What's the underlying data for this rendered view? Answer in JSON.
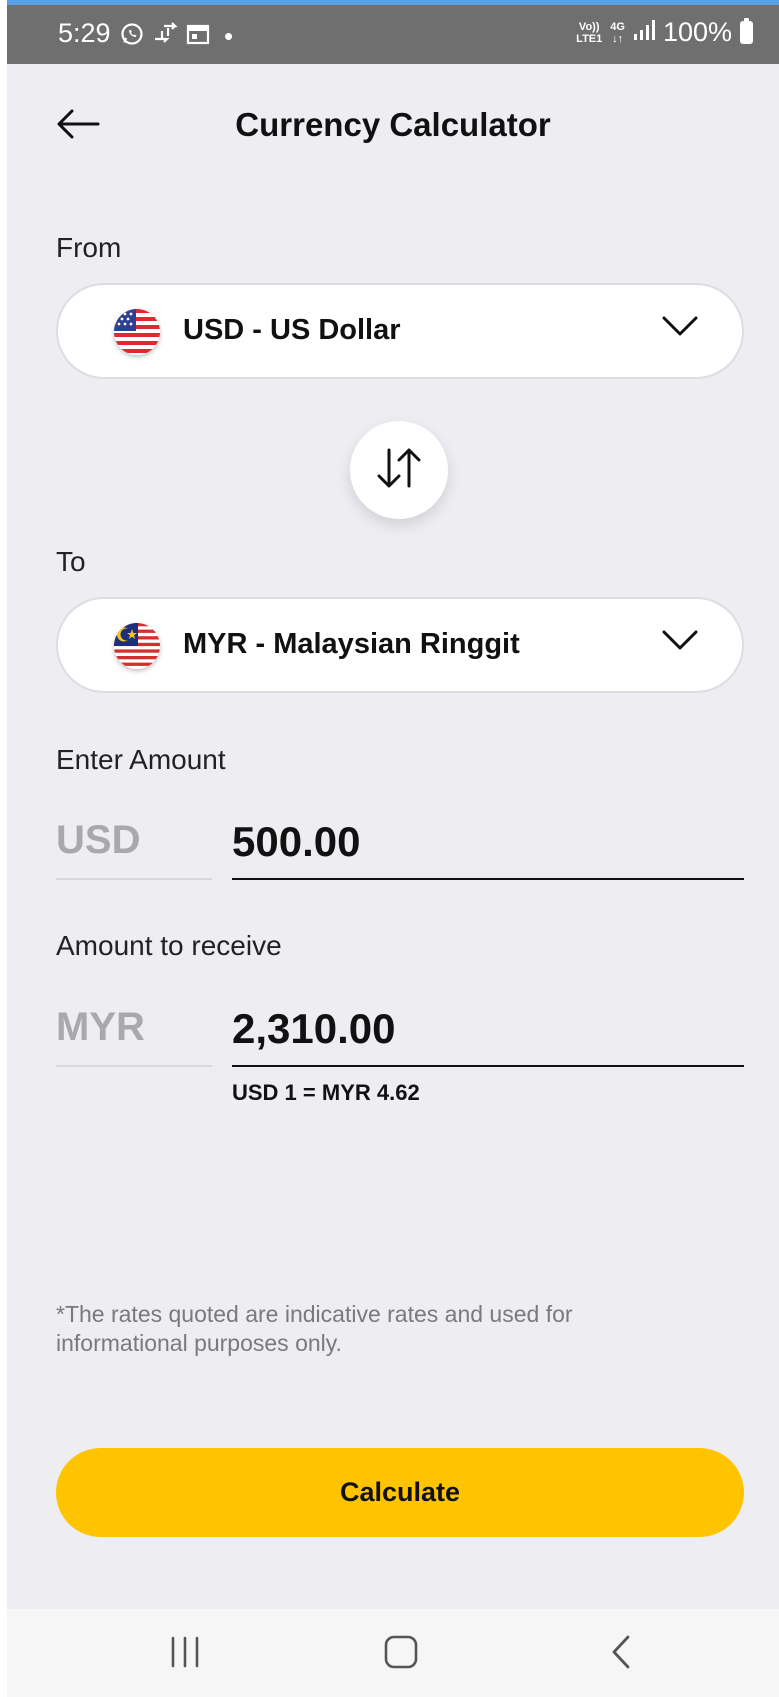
{
  "status_bar": {
    "time": "5:29",
    "dot": "•",
    "network_top": "Vo))",
    "network_bottom": "LTE1",
    "signal_label": "4G",
    "battery": "100%",
    "icons": [
      "whatsapp-icon",
      "transfer-icon",
      "calendar-icon",
      "signal-icon",
      "battery-icon"
    ]
  },
  "header": {
    "title": "Currency Calculator",
    "back_icon": "arrow-left-icon"
  },
  "from": {
    "label": "From",
    "currency": "USD - US Dollar",
    "flag": "us-flag-icon"
  },
  "swap_icon": "swap-arrows-icon",
  "to": {
    "label": "To",
    "currency": "MYR - Malaysian Ringgit",
    "flag": "malaysia-flag-icon"
  },
  "enter_amount": {
    "label": "Enter Amount",
    "currency_code": "USD",
    "value": "500.00"
  },
  "receive": {
    "label": "Amount to receive",
    "currency_code": "MYR",
    "value": "2,310.00",
    "rate": "USD 1 = MYR 4.62"
  },
  "disclaimer": "*The rates quoted are indicative rates and used for informational purposes only.",
  "calculate_button": "Calculate",
  "colors": {
    "accent": "#ffc400",
    "background": "#eeedf2",
    "status_bar": "#6f6f6f"
  },
  "nav_bar": {
    "icons": [
      "recent-apps-icon",
      "home-icon",
      "back-icon"
    ]
  }
}
